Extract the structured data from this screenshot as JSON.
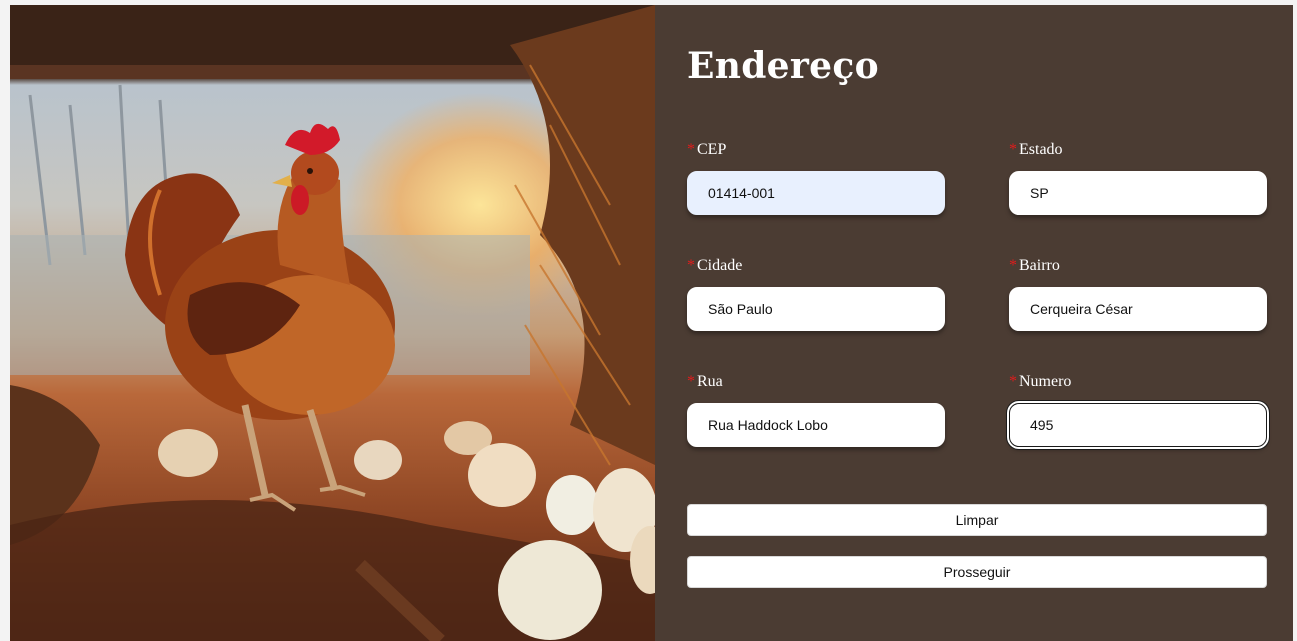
{
  "photo": {
    "description_icon": "chicken-with-eggs-photo"
  },
  "form": {
    "title": "Endereço",
    "required_mark": "*",
    "fields": {
      "cep": {
        "label": "CEP",
        "value": "01414-001"
      },
      "estado": {
        "label": "Estado",
        "value": "SP"
      },
      "cidade": {
        "label": "Cidade",
        "value": "São Paulo"
      },
      "bairro": {
        "label": "Bairro",
        "value": "Cerqueira César"
      },
      "rua": {
        "label": "Rua",
        "value": "Rua Haddock Lobo"
      },
      "numero": {
        "label": "Numero",
        "value": "495"
      }
    },
    "buttons": {
      "clear": "Limpar",
      "proceed": "Prosseguir"
    }
  },
  "colors": {
    "panel_bg": "#4b3c33",
    "required": "#e01c1c",
    "autofill_bg": "#e8f0fe"
  }
}
